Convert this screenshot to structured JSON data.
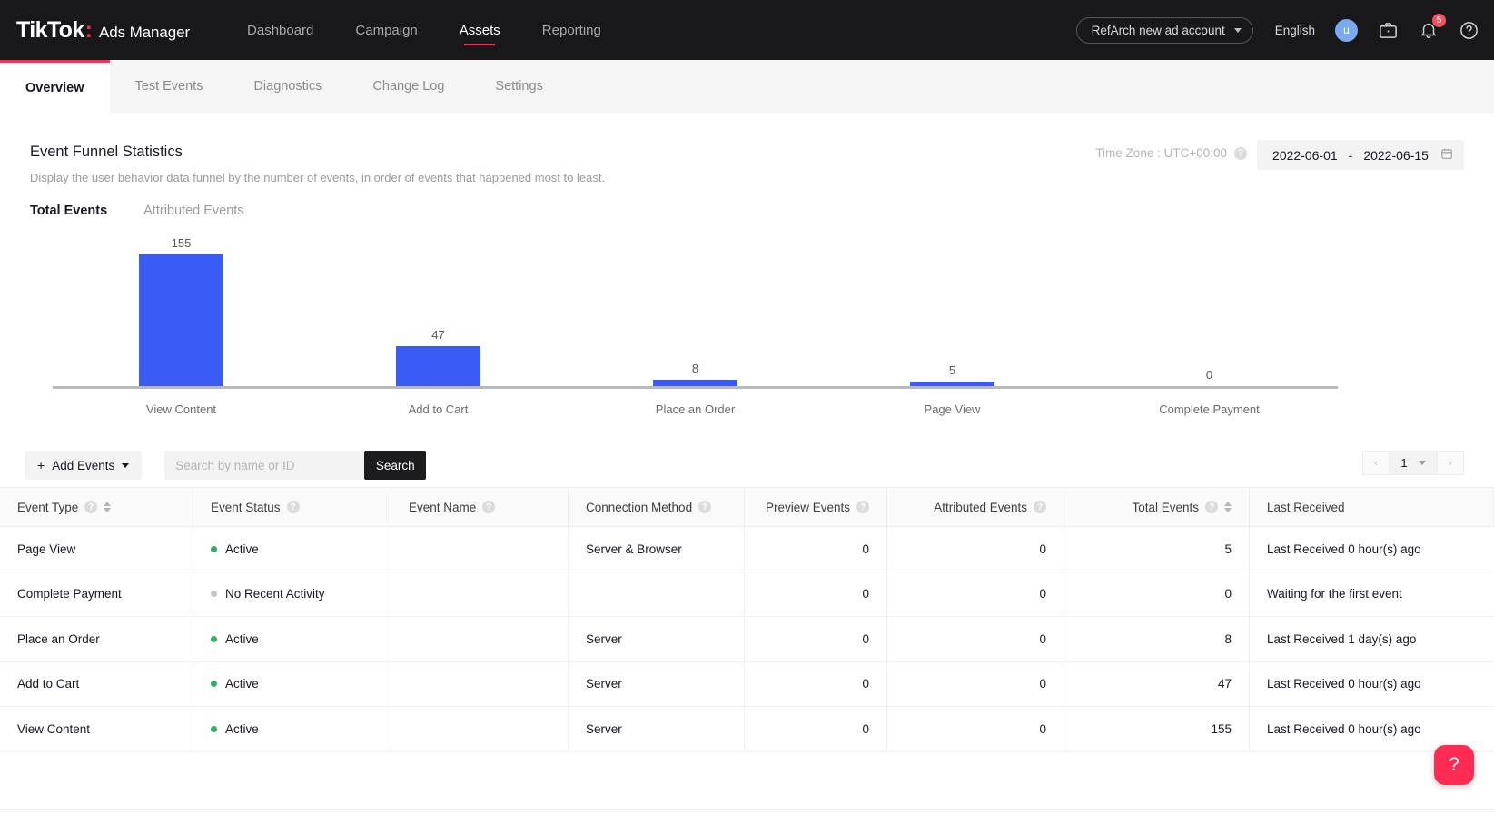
{
  "header": {
    "brand_name": "TikTok",
    "brand_dot": ":",
    "brand_sub": "Ads Manager",
    "nav": [
      {
        "label": "Dashboard",
        "active": false
      },
      {
        "label": "Campaign",
        "active": false
      },
      {
        "label": "Assets",
        "active": true
      },
      {
        "label": "Reporting",
        "active": false
      }
    ],
    "account_label": "RefArch new ad account",
    "language_label": "English",
    "avatar_initial": "u",
    "notification_count": "5"
  },
  "tabs": [
    {
      "label": "Overview",
      "active": true
    },
    {
      "label": "Test Events",
      "active": false
    },
    {
      "label": "Diagnostics",
      "active": false
    },
    {
      "label": "Change Log",
      "active": false
    },
    {
      "label": "Settings",
      "active": false
    }
  ],
  "section": {
    "title": "Event Funnel Statistics",
    "description": "Display the user behavior data funnel by the number of events, in order of events that happened most to least.",
    "timezone_label": "Time Zone : UTC+00:00",
    "date_start": "2022-06-01",
    "date_separator": "-",
    "date_end": "2022-06-15",
    "subtabs": [
      {
        "label": "Total Events",
        "active": true
      },
      {
        "label": "Attributed Events",
        "active": false
      }
    ]
  },
  "chart_data": {
    "type": "bar",
    "title": "Event Funnel Statistics",
    "xlabel": "",
    "ylabel": "",
    "categories": [
      "View Content",
      "Add to Cart",
      "Place an Order",
      "Page View",
      "Complete Payment"
    ],
    "values": [
      155,
      47,
      8,
      5,
      0
    ],
    "value_labels": [
      "155",
      "47",
      "8",
      "5",
      "0"
    ],
    "ylim": [
      0,
      155
    ],
    "grid": false,
    "legend": "none",
    "bar_color": "#3b5bf5",
    "axis_color": "#b9b9bd"
  },
  "toolbar": {
    "add_events_label": "Add Events",
    "add_events_plus": "+",
    "search_placeholder": "Search by name or ID",
    "search_value": "",
    "search_button_label": "Search",
    "page_number": "1",
    "prev_label": "‹",
    "next_label": "›"
  },
  "table": {
    "columns": [
      {
        "label": "Event Type",
        "has_info": true,
        "has_sort": true,
        "align": "left"
      },
      {
        "label": "Event Status",
        "has_info": true,
        "has_sort": false,
        "align": "left"
      },
      {
        "label": "Event Name",
        "has_info": true,
        "has_sort": false,
        "align": "left"
      },
      {
        "label": "Connection Method",
        "has_info": true,
        "has_sort": false,
        "align": "left"
      },
      {
        "label": "Preview Events",
        "has_info": true,
        "has_sort": false,
        "align": "right"
      },
      {
        "label": "Attributed Events",
        "has_info": true,
        "has_sort": false,
        "align": "right"
      },
      {
        "label": "Total Events",
        "has_info": true,
        "has_sort": true,
        "align": "right"
      },
      {
        "label": "Last Received",
        "has_info": false,
        "has_sort": false,
        "align": "left"
      }
    ],
    "rows": [
      {
        "event_type": "Page View",
        "event_status": "Active",
        "status_state": "active",
        "event_name": "",
        "connection_method": "Server & Browser",
        "preview_events": "0",
        "attributed_events": "0",
        "total_events": "5",
        "last_received": "Last Received 0 hour(s) ago"
      },
      {
        "event_type": "Complete Payment",
        "event_status": "No Recent Activity",
        "status_state": "idle",
        "event_name": "",
        "connection_method": "",
        "preview_events": "0",
        "attributed_events": "0",
        "total_events": "0",
        "last_received": "Waiting for the first event"
      },
      {
        "event_type": "Place an Order",
        "event_status": "Active",
        "status_state": "active",
        "event_name": "",
        "connection_method": "Server",
        "preview_events": "0",
        "attributed_events": "0",
        "total_events": "8",
        "last_received": "Last Received 1 day(s) ago"
      },
      {
        "event_type": "Add to Cart",
        "event_status": "Active",
        "status_state": "active",
        "event_name": "",
        "connection_method": "Server",
        "preview_events": "0",
        "attributed_events": "0",
        "total_events": "47",
        "last_received": "Last Received 0 hour(s) ago"
      },
      {
        "event_type": "View Content",
        "event_status": "Active",
        "status_state": "active",
        "event_name": "",
        "connection_method": "Server",
        "preview_events": "0",
        "attributed_events": "0",
        "total_events": "155",
        "last_received": "Last Received 0 hour(s) ago"
      }
    ]
  },
  "help_fab": {
    "glyph": "?"
  },
  "colors": {
    "brand_red": "#fe2c55",
    "bar_blue": "#3b5bf5",
    "status_active": "#2fae6a",
    "status_idle": "#c4c4c8",
    "nav_bg": "#18181a"
  }
}
